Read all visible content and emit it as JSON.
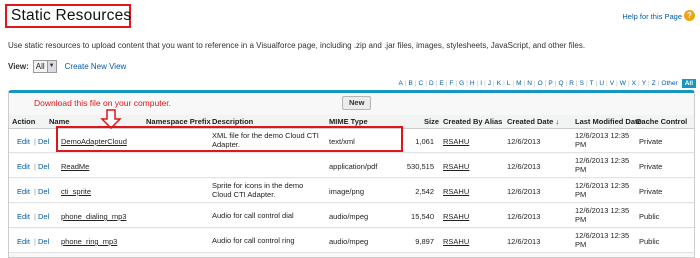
{
  "page": {
    "title": "Static Resources",
    "help_link": "Help for this Page",
    "help_icon": "?",
    "description": "Use static resources to upload content that you want to reference in a Visualforce page, including .zip and .jar files, images, stylesheets, JavaScript, and other files."
  },
  "view": {
    "label": "View:",
    "selected": "All",
    "create_link": "Create New View"
  },
  "alphabet": [
    "A",
    "B",
    "C",
    "D",
    "E",
    "F",
    "G",
    "H",
    "I",
    "J",
    "K",
    "L",
    "M",
    "N",
    "O",
    "P",
    "Q",
    "R",
    "S",
    "T",
    "U",
    "V",
    "W",
    "X",
    "Y",
    "Z",
    "Other"
  ],
  "alphabet_all": "All",
  "annotation": {
    "note": "Download this file on your computer.",
    "color": "#e0161b"
  },
  "toolbar": {
    "new_label": "New"
  },
  "table": {
    "headers": {
      "action": "Action",
      "name": "Name",
      "ns": "Namespace Prefix",
      "desc": "Description",
      "mime": "MIME Type",
      "size": "Size",
      "alias": "Created By Alias",
      "created": "Created Date",
      "sort_indicator": "↓",
      "modified": "Last Modified Date",
      "cache": "Cache Control"
    },
    "edit": "Edit",
    "del": "Del",
    "sep": "|",
    "rows": [
      {
        "name": "DemoAdapterCloud",
        "desc1": "XML file for the demo Cloud CTI",
        "desc2": "Adapter.",
        "mime": "text/xml",
        "size": "1,061",
        "alias": "RSAHU",
        "created": "12/6/2013",
        "mod1": "12/6/2013 12:35",
        "mod2": "PM",
        "cache": "Private"
      },
      {
        "name": "ReadMe",
        "desc1": "",
        "desc2": "",
        "mime": "application/pdf",
        "size": "530,515",
        "alias": "RSAHU",
        "created": "12/6/2013",
        "mod1": "12/6/2013 12:35",
        "mod2": "PM",
        "cache": "Private"
      },
      {
        "name": "cti_sprite",
        "desc1": "Sprite for icons in the demo",
        "desc2": "Cloud CTI Adapter.",
        "mime": "image/png",
        "size": "2,542",
        "alias": "RSAHU",
        "created": "12/6/2013",
        "mod1": "12/6/2013 12:35",
        "mod2": "PM",
        "cache": "Private"
      },
      {
        "name": "phone_dialing_mp3",
        "desc1": "Audio for call control dial",
        "desc2": "",
        "mime": "audio/mpeg",
        "size": "15,540",
        "alias": "RSAHU",
        "created": "12/6/2013",
        "mod1": "12/6/2013 12:35",
        "mod2": "PM",
        "cache": "Public"
      },
      {
        "name": "phone_ring_mp3",
        "desc1": "Audio for call control ring",
        "desc2": "",
        "mime": "audio/mpeg",
        "size": "9,897",
        "alias": "RSAHU",
        "created": "12/6/2013",
        "mod1": "12/6/2013 12:35",
        "mod2": "PM",
        "cache": "Public"
      }
    ]
  }
}
